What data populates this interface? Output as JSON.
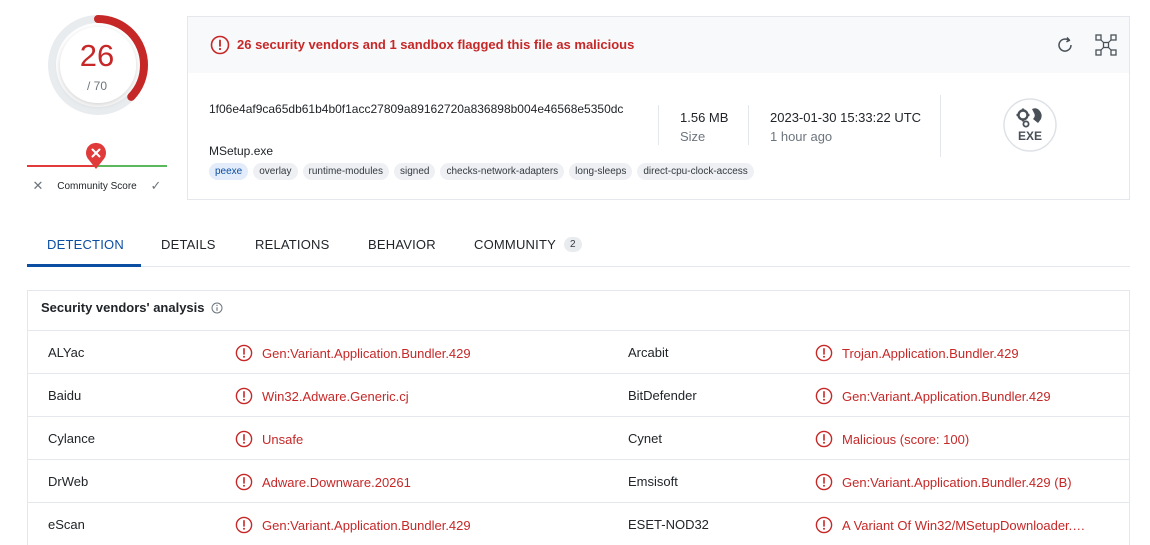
{
  "score": {
    "detections": "26",
    "total": "/ 70",
    "fraction": 0.371,
    "ring_color": "#c62828"
  },
  "community": {
    "label": "Community Score",
    "vote_bad": "✕",
    "vote_good": "✓"
  },
  "banner": {
    "message": "26 security vendors and 1 sandbox flagged this file as malicious",
    "icon": "alert-circle-icon",
    "color": "#c62828"
  },
  "file": {
    "hash": "1f06e4af9ca65db61b4b0f1acc27809a89162720a836898b004e46568e5350dc",
    "name": "MSetup.exe",
    "tags": [
      "peexe",
      "overlay",
      "runtime-modules",
      "signed",
      "checks-network-adapters",
      "long-sleeps",
      "direct-cpu-clock-access"
    ],
    "size_value": "1.56 MB",
    "size_label": "Size",
    "date_value": "2023-01-30 15:33:22 UTC",
    "date_label": "1 hour ago",
    "type_badge": "EXE"
  },
  "tabs": [
    {
      "label": "DETECTION",
      "active": true
    },
    {
      "label": "DETAILS"
    },
    {
      "label": "RELATIONS"
    },
    {
      "label": "BEHAVIOR"
    },
    {
      "label": "COMMUNITY",
      "badge": "2"
    }
  ],
  "vendors": {
    "title": "Security vendors' analysis",
    "rows": [
      {
        "left_name": "ALYac",
        "left_result": "Gen:Variant.Application.Bundler.429",
        "right_name": "Arcabit",
        "right_result": "Trojan.Application.Bundler.429"
      },
      {
        "left_name": "Baidu",
        "left_result": "Win32.Adware.Generic.cj",
        "right_name": "BitDefender",
        "right_result": "Gen:Variant.Application.Bundler.429"
      },
      {
        "left_name": "Cylance",
        "left_result": "Unsafe",
        "right_name": "Cynet",
        "right_result": "Malicious (score: 100)"
      },
      {
        "left_name": "DrWeb",
        "left_result": "Adware.Downware.20261",
        "right_name": "Emsisoft",
        "right_result": "Gen:Variant.Application.Bundler.429 (B)"
      },
      {
        "left_name": "eScan",
        "left_result": "Gen:Variant.Application.Bundler.429",
        "right_name": "ESET-NOD32",
        "right_result": "A Variant Of Win32/MSetupDownloader.…"
      }
    ]
  },
  "colors": {
    "accent": "#0b4ea2",
    "malicious": "#c62828",
    "border": "#e4e7eb"
  }
}
